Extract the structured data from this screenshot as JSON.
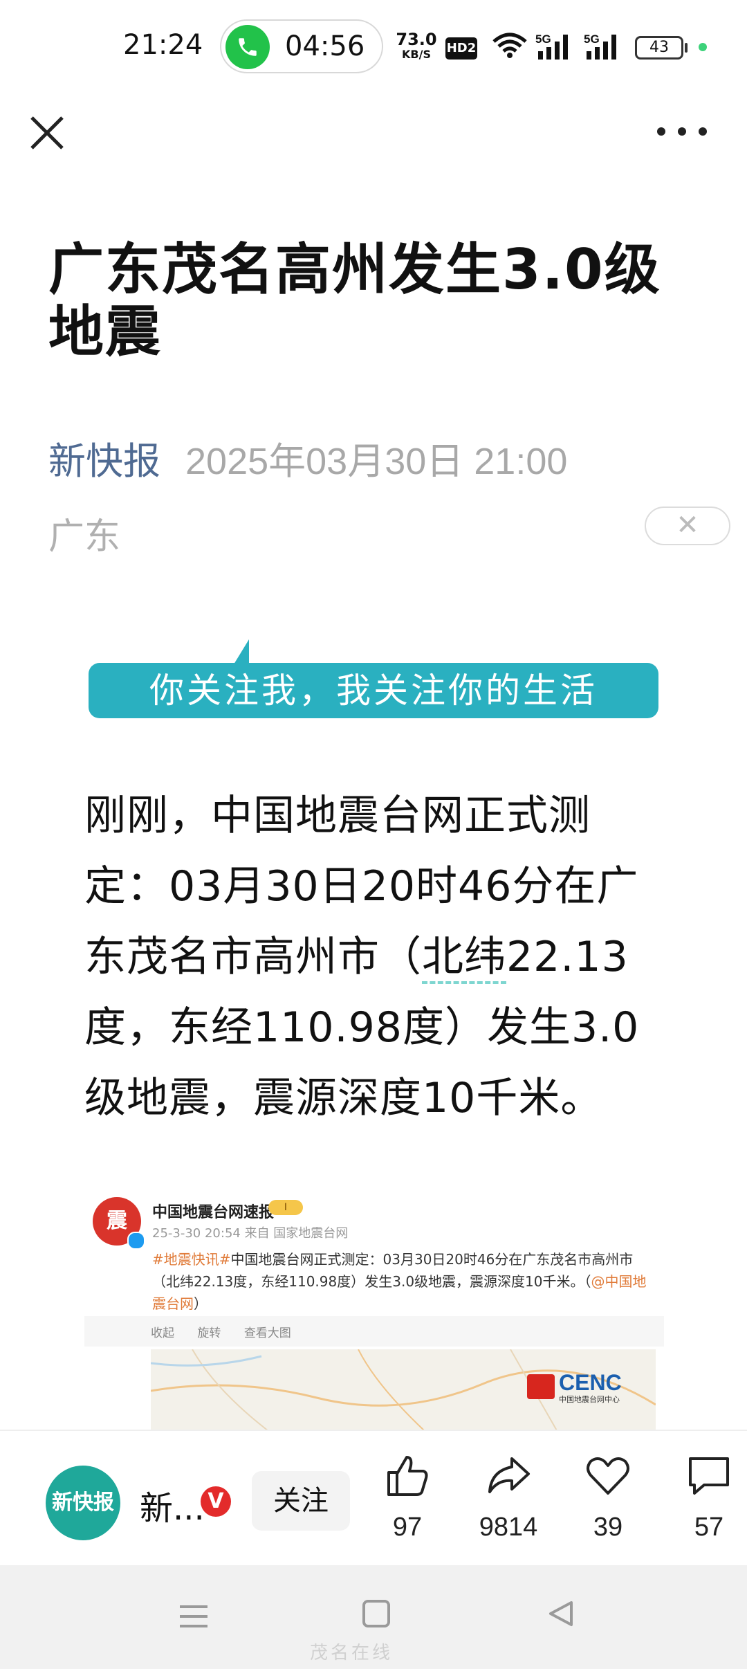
{
  "status_bar": {
    "time": "21:24",
    "call_timer": "04:56",
    "net_speed_value": "73.0",
    "net_speed_unit": "KB/S",
    "hd_badge": "HD2",
    "signal_1_label": "5G",
    "signal_2_label": "5G",
    "battery": "43"
  },
  "nav": {
    "close_icon": "close-icon",
    "more_icon": "more-icon"
  },
  "article": {
    "title": "广东茂名高州发生3.0级地震",
    "source": "新快报",
    "date": "2025年03月30日 21:00",
    "region": "广东",
    "region_dismiss": "✕",
    "banner": "你关注我，我关注你的生活",
    "body_pre": "刚刚，中国地震台网正式测定：03月30日20时46分在广东茂名市高州市（",
    "body_mark": "北纬",
    "body_post": "22.13度，东经110.98度）发生3.0级地震，震源深度10千米。"
  },
  "embed": {
    "avatar_text": "震",
    "name": "中国地震台网速报",
    "crown": "I",
    "time": "25-3-30 20:54  来自 国家地震台网",
    "tag": "#地震快讯#",
    "text": "中国地震台网正式测定：03月30日20时46分在广东茂名市高州市（北纬22.13度，东经110.98度）发生3.0级地震，震源深度10千米。（",
    "mention": "@中国地震台网",
    "text_end": "）",
    "actions": [
      "收起",
      "旋转",
      "查看大图"
    ],
    "map_logo": "CENC",
    "map_logo_sub": "中国地震台网中心"
  },
  "bottom_bar": {
    "avatar_text": "新快报",
    "account_name": "新...",
    "verified": "V",
    "follow_label": "关注",
    "likes": "97",
    "shares": "9814",
    "favorites": "39",
    "comments": "57"
  },
  "watermark": "茂名在线"
}
